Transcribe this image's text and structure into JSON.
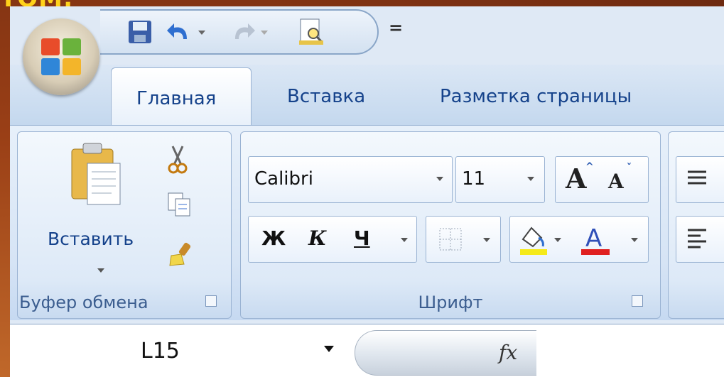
{
  "slide": {
    "title_fragment": "ТОМ:"
  },
  "quick_access": {
    "icons": [
      "save-icon",
      "undo-icon",
      "redo-icon",
      "print-preview-icon",
      "customize-qat-icon"
    ]
  },
  "tabs": [
    {
      "label": "Главная",
      "active": true
    },
    {
      "label": "Вставка",
      "active": false
    },
    {
      "label": "Разметка страницы",
      "active": false
    }
  ],
  "clipboard": {
    "paste_label": "Вставить",
    "group_label": "Буфер обмена"
  },
  "font": {
    "font_name": "Calibri",
    "font_size": "11",
    "bold_label": "Ж",
    "italic_label": "К",
    "underline_label": "Ч",
    "grow_label": "A",
    "shrink_label": "A",
    "fill_color": "#f5ea1a",
    "font_color": "#e02020",
    "group_label": "Шрифт"
  },
  "formula_bar": {
    "name_box": "L15",
    "fx_label": "fx"
  }
}
